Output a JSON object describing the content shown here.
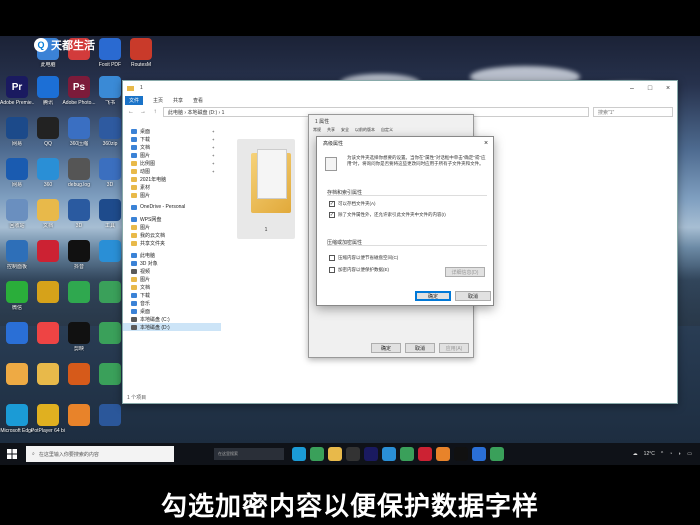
{
  "branding": {
    "logo_text": "天都生活",
    "logo_letter": "Q"
  },
  "desktop": {
    "top_icons": [
      {
        "label": "Administrat...",
        "icon": "user-folder-icon",
        "color": "#e8b94a"
      },
      {
        "label": "此电脑",
        "icon": "computer-icon",
        "color": "#3b82d6"
      },
      {
        "label": "",
        "icon": "file-icon",
        "color": "#d23b3b"
      },
      {
        "label": "Foxit PDF",
        "icon": "pdf-icon",
        "color": "#2a6ad1"
      },
      {
        "label": "RoutesM",
        "icon": "app-icon",
        "color": "#c93a2a"
      }
    ],
    "left_icons": [
      {
        "label": "Adobe Premie...",
        "icon": "premiere-icon",
        "glyph": "Pr",
        "color": "#1a1a60"
      },
      {
        "label": "腾讯",
        "icon": "app-icon",
        "glyph": "",
        "color": "#1c6fd6"
      },
      {
        "label": "Adobe Photo...",
        "icon": "photoshop-icon",
        "glyph": "Ps",
        "color": "#7c1b3a"
      },
      {
        "label": "飞书",
        "icon": "app-icon",
        "glyph": "",
        "color": "#3a8ad6"
      },
      {
        "label": "网易",
        "icon": "app-icon",
        "glyph": "",
        "color": "#1c4a8a"
      },
      {
        "label": "QQ",
        "icon": "qq-icon",
        "glyph": "",
        "color": "#222"
      },
      {
        "label": "360压缩",
        "icon": "archive-icon",
        "glyph": "",
        "color": "#3a6fc2"
      },
      {
        "label": "360zip",
        "icon": "archive-icon",
        "glyph": "",
        "color": "#2e5aa0"
      },
      {
        "label": "网易",
        "icon": "app-icon",
        "glyph": "",
        "color": "#1a5bb0"
      },
      {
        "label": "360",
        "icon": "app-icon",
        "glyph": "",
        "color": "#2a8fd6"
      },
      {
        "label": "debug.log",
        "icon": "file-icon",
        "glyph": "",
        "color": "#555"
      },
      {
        "label": "3D",
        "icon": "app-icon",
        "glyph": "",
        "color": "#3b6fbf"
      },
      {
        "label": "回收站",
        "icon": "recycle-bin-icon",
        "glyph": "",
        "color": "#6a8fbf"
      },
      {
        "label": "文档",
        "icon": "folder-icon",
        "glyph": "",
        "color": "#e8b94a"
      },
      {
        "label": "3D",
        "icon": "app-icon",
        "glyph": "",
        "color": "#2a5aa0"
      },
      {
        "label": "工具",
        "icon": "app-icon",
        "glyph": "",
        "color": "#1e4b8c"
      },
      {
        "label": "控制面板",
        "icon": "control-panel-icon",
        "glyph": "",
        "color": "#2e6fb8"
      },
      {
        "label": "",
        "icon": "app-icon",
        "glyph": "",
        "color": "#c23"
      },
      {
        "label": "抖音",
        "icon": "tiktok-icon",
        "glyph": "",
        "color": "#111"
      },
      {
        "label": "",
        "icon": "app-icon",
        "glyph": "",
        "color": "#2a8fd6"
      },
      {
        "label": "微信",
        "icon": "wechat-icon",
        "glyph": "",
        "color": "#2aae3a"
      },
      {
        "label": "",
        "icon": "app-icon",
        "glyph": "",
        "color": "#d6a21a"
      },
      {
        "label": "",
        "icon": "app-icon",
        "glyph": "",
        "color": "#2fa84f"
      },
      {
        "label": "",
        "icon": "app-icon",
        "glyph": "",
        "color": "#3aa05a"
      },
      {
        "label": "",
        "icon": "shield-icon",
        "glyph": "",
        "color": "#2a6fd6"
      },
      {
        "label": "",
        "icon": "app-icon",
        "glyph": "",
        "color": "#e44"
      },
      {
        "label": "剪映",
        "icon": "capcut-icon",
        "glyph": "",
        "color": "#111"
      },
      {
        "label": "",
        "icon": "app-icon",
        "glyph": "",
        "color": "#3aa05a"
      },
      {
        "label": "",
        "icon": "app-icon",
        "glyph": "",
        "color": "#ea4"
      },
      {
        "label": "",
        "icon": "app-icon",
        "glyph": "",
        "color": "#e8b94a"
      },
      {
        "label": "",
        "icon": "app-icon",
        "glyph": "",
        "color": "#d65a1a"
      },
      {
        "label": "",
        "icon": "app-icon",
        "glyph": "",
        "color": "#3aa05a"
      },
      {
        "label": "Microsoft Edge",
        "icon": "edge-icon",
        "glyph": "",
        "color": "#1b9bd6"
      },
      {
        "label": "PotPlayer 64 bit",
        "icon": "potplayer-icon",
        "glyph": "",
        "color": "#e0b020"
      },
      {
        "label": "",
        "icon": "app-icon",
        "glyph": "",
        "color": "#e8832a"
      },
      {
        "label": "",
        "icon": "word-icon",
        "glyph": "",
        "color": "#2b579a"
      }
    ]
  },
  "explorer": {
    "title": "1",
    "menu": [
      "文件",
      "主页",
      "共享",
      "查看"
    ],
    "address": "此电脑 › 本地磁盘 (D:) › 1",
    "search_placeholder": "搜索\"1\"",
    "nav_items": [
      {
        "label": "桌面",
        "type": "b",
        "pinned": true
      },
      {
        "label": "下载",
        "type": "b",
        "pinned": true
      },
      {
        "label": "文档",
        "type": "b",
        "pinned": true
      },
      {
        "label": "图片",
        "type": "b",
        "pinned": true
      },
      {
        "label": "比例图",
        "type": "y",
        "pinned": true
      },
      {
        "label": "动图",
        "type": "y",
        "pinned": true
      },
      {
        "label": "2021年电脑",
        "type": "y",
        "pinned": false
      },
      {
        "label": "素材",
        "type": "y",
        "pinned": false
      },
      {
        "label": "图片",
        "type": "y",
        "pinned": false
      },
      {
        "gap": true
      },
      {
        "label": "OneDrive - Personal",
        "type": "b",
        "pinned": false
      },
      {
        "gap": true
      },
      {
        "label": "WPS网盘",
        "type": "b",
        "pinned": false
      },
      {
        "label": "图片",
        "type": "y",
        "pinned": false
      },
      {
        "label": "我的云文档",
        "type": "y",
        "pinned": false
      },
      {
        "label": "共享文件夹",
        "type": "y",
        "pinned": false
      },
      {
        "gap": true
      },
      {
        "label": "此电脑",
        "type": "b",
        "pinned": false
      },
      {
        "label": "3D 对象",
        "type": "b",
        "pinned": false
      },
      {
        "label": "视频",
        "type": "g",
        "pinned": false
      },
      {
        "label": "图片",
        "type": "y",
        "pinned": false
      },
      {
        "label": "文档",
        "type": "y",
        "pinned": false
      },
      {
        "label": "下载",
        "type": "b",
        "pinned": false
      },
      {
        "label": "音乐",
        "type": "b",
        "pinned": false
      },
      {
        "label": "桌面",
        "type": "b",
        "pinned": false
      },
      {
        "label": "本地磁盘 (C:)",
        "type": "g",
        "pinned": false
      },
      {
        "label": "本地磁盘 (D:)",
        "type": "g",
        "pinned": false,
        "selected": true
      }
    ],
    "folder_name": "1",
    "status": "1 个项目"
  },
  "properties": {
    "title": "1 属性",
    "tabs": [
      "常规",
      "共享",
      "安全",
      "以前的版本",
      "自定义"
    ],
    "buttons": {
      "ok": "确定",
      "cancel": "取消",
      "apply": "应用(A)"
    }
  },
  "advanced": {
    "title": "高级属性",
    "close": "×",
    "description": "为该文件夹选择你想要的设置。当你在\"属性\"对话框中单击\"确定\"或\"应用\"时，将询问你是否要将这些更改同时应用于所有子文件夹和文件。",
    "section_archive": "存档和索引属性",
    "archive_ready": {
      "label": "可以存档文件夹(A)",
      "checked": true
    },
    "index": {
      "label": "除了文件属性外，还允许索引此文件夹中文件的内容(I)",
      "checked": true
    },
    "section_compress": "压缩或加密属性",
    "compress": {
      "label": "压缩内容以便节省磁盘空间(C)",
      "checked": false
    },
    "encrypt": {
      "label": "加密内容以便保护数据(E)",
      "checked": false
    },
    "details_button": "详细信息(D)",
    "ok": "确定",
    "cancel": "取消"
  },
  "taskbar": {
    "search_placeholder": "在这里输入你要搜索的内容",
    "search2_placeholder": "在这里搜索",
    "apps": [
      {
        "icon": "edge-icon",
        "color": "#1b9bd6"
      },
      {
        "icon": "chrome-icon",
        "color": "#3aa05a"
      },
      {
        "icon": "file-explorer-icon",
        "color": "#e8b94a"
      },
      {
        "icon": "app-icon",
        "color": "#333"
      },
      {
        "icon": "premiere-icon",
        "color": "#1a1a60"
      },
      {
        "icon": "app-icon",
        "color": "#2a8fd6"
      },
      {
        "icon": "app-icon",
        "color": "#3aa05a"
      },
      {
        "icon": "wps-icon",
        "color": "#c23"
      },
      {
        "icon": "app-icon",
        "color": "#e8832a"
      },
      {
        "icon": "app-icon",
        "color": "#111"
      },
      {
        "icon": "app-icon",
        "color": "#2a6fd6"
      },
      {
        "icon": "app-icon",
        "color": "#3aa05a"
      }
    ],
    "weather": "12°C",
    "time": ""
  },
  "caption": "勾选加密内容以便保护数据字样"
}
